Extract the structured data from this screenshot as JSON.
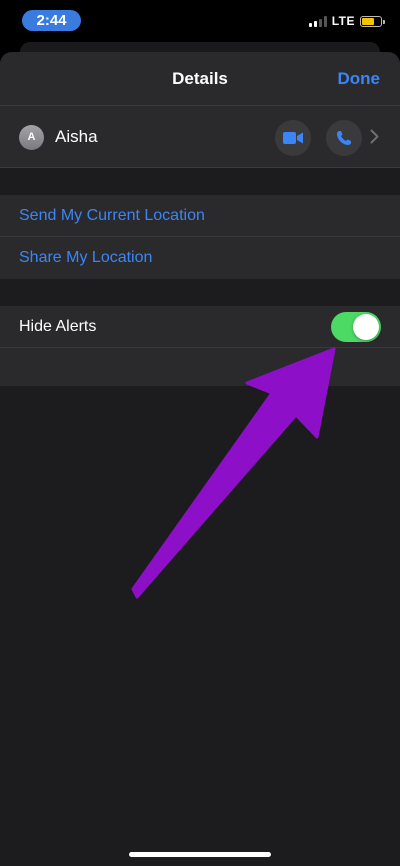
{
  "status_bar": {
    "time": "2:44",
    "network": "LTE",
    "battery_color": "#f5c400"
  },
  "nav": {
    "title": "Details",
    "done_label": "Done"
  },
  "contact": {
    "avatar_initial": "A",
    "name": "Aisha",
    "video_icon": "video-camera-icon",
    "phone_icon": "phone-icon"
  },
  "location": {
    "send_current": "Send My Current Location",
    "share": "Share My Location"
  },
  "alerts": {
    "label": "Hide Alerts",
    "toggle_on": true,
    "toggle_color": "#4cd964"
  },
  "colors": {
    "accent": "#3b86f7",
    "annotation_arrow": "#8e0fc8"
  }
}
